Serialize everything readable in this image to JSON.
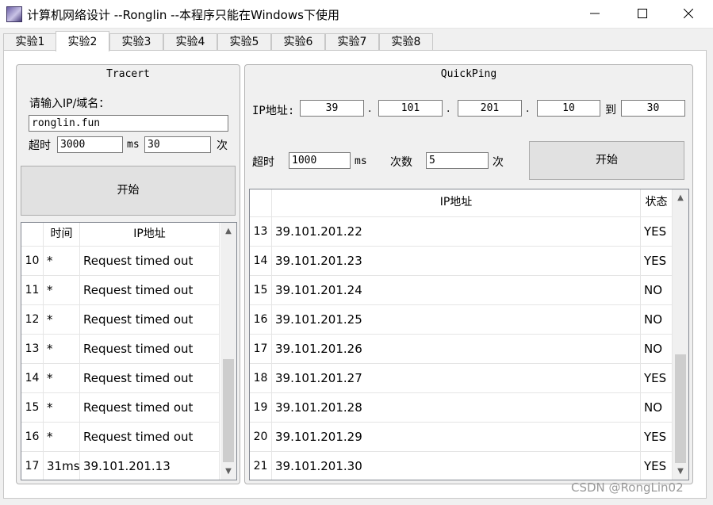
{
  "window": {
    "title": "计算机网络设计 --Ronglin  --本程序只能在Windows下使用"
  },
  "tabs": [
    "实验1",
    "实验2",
    "实验3",
    "实验4",
    "实验5",
    "实验6",
    "实验7",
    "实验8"
  ],
  "tracert": {
    "title": "Tracert",
    "prompt": "请输入IP/域名：",
    "host_value": "ronglin.fun",
    "timeout_label": "超时",
    "timeout_value": "3000",
    "ms_label": "ms",
    "count_value": "30",
    "count_unit": "次",
    "start_label": "开始",
    "columns": [
      "时间",
      "IP地址"
    ],
    "rows": [
      {
        "n": "10",
        "time": "*",
        "ip": "Request timed out"
      },
      {
        "n": "11",
        "time": "*",
        "ip": "Request timed out"
      },
      {
        "n": "12",
        "time": "*",
        "ip": "Request timed out"
      },
      {
        "n": "13",
        "time": "*",
        "ip": "Request timed out"
      },
      {
        "n": "14",
        "time": "*",
        "ip": "Request timed out"
      },
      {
        "n": "15",
        "time": "*",
        "ip": "Request timed out"
      },
      {
        "n": "16",
        "time": "*",
        "ip": "Request timed out"
      },
      {
        "n": "17",
        "time": "31ms",
        "ip": "39.101.201.13"
      }
    ]
  },
  "quickping": {
    "title": "QuickPing",
    "ip_label": "IP地址:",
    "octet1": "39",
    "octet2": "101",
    "octet3": "201",
    "octet4": "10",
    "dot": ".",
    "to_label": "到",
    "to_value": "30",
    "timeout_label": "超时",
    "timeout_value": "1000",
    "ms_label": "ms",
    "count_label": "次数",
    "count_value": "5",
    "count_unit": "次",
    "start_label": "开始",
    "columns": [
      "IP地址",
      "状态"
    ],
    "rows": [
      {
        "n": "13",
        "ip": "39.101.201.22",
        "status": "YES"
      },
      {
        "n": "14",
        "ip": "39.101.201.23",
        "status": "YES"
      },
      {
        "n": "15",
        "ip": "39.101.201.24",
        "status": "NO"
      },
      {
        "n": "16",
        "ip": "39.101.201.25",
        "status": "NO"
      },
      {
        "n": "17",
        "ip": "39.101.201.26",
        "status": "NO"
      },
      {
        "n": "18",
        "ip": "39.101.201.27",
        "status": "YES"
      },
      {
        "n": "19",
        "ip": "39.101.201.28",
        "status": "NO"
      },
      {
        "n": "20",
        "ip": "39.101.201.29",
        "status": "YES"
      },
      {
        "n": "21",
        "ip": "39.101.201.30",
        "status": "YES"
      }
    ]
  },
  "watermark": "CSDN @RongLin02"
}
